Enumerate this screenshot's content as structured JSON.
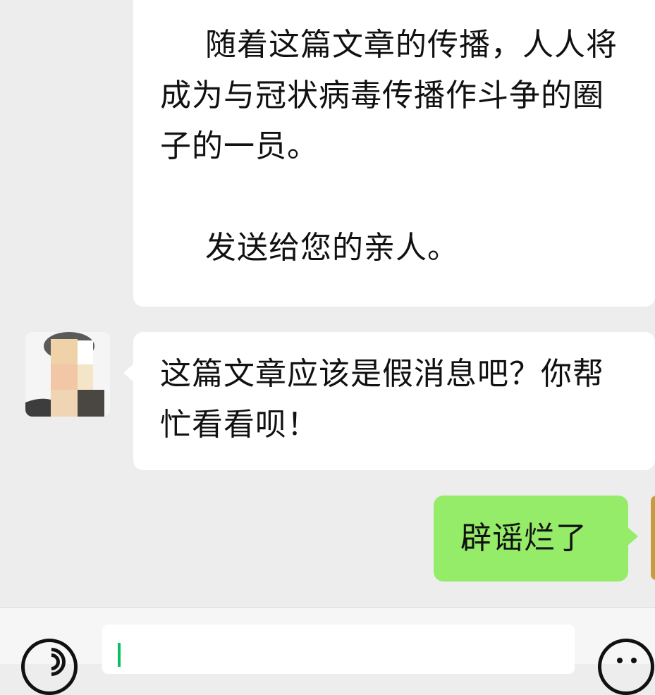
{
  "messages": {
    "incoming_1": {
      "para1": "随着这篇文章的传播，人人将成为与冠状病毒传播作斗争的圈子的一员。",
      "para2": "发送给您的亲人。"
    },
    "incoming_2": {
      "text": "这篇文章应该是假消息吧？你帮忙看看呗！"
    },
    "outgoing_1": {
      "text": "辟谣烂了"
    }
  },
  "input": {
    "value": ""
  },
  "icons": {
    "voice": "voice-icon",
    "emoji": "emoji-icon"
  },
  "colors": {
    "background": "#ededed",
    "incoming_bubble": "#ffffff",
    "outgoing_bubble": "#95ec69",
    "caret": "#07c160"
  }
}
